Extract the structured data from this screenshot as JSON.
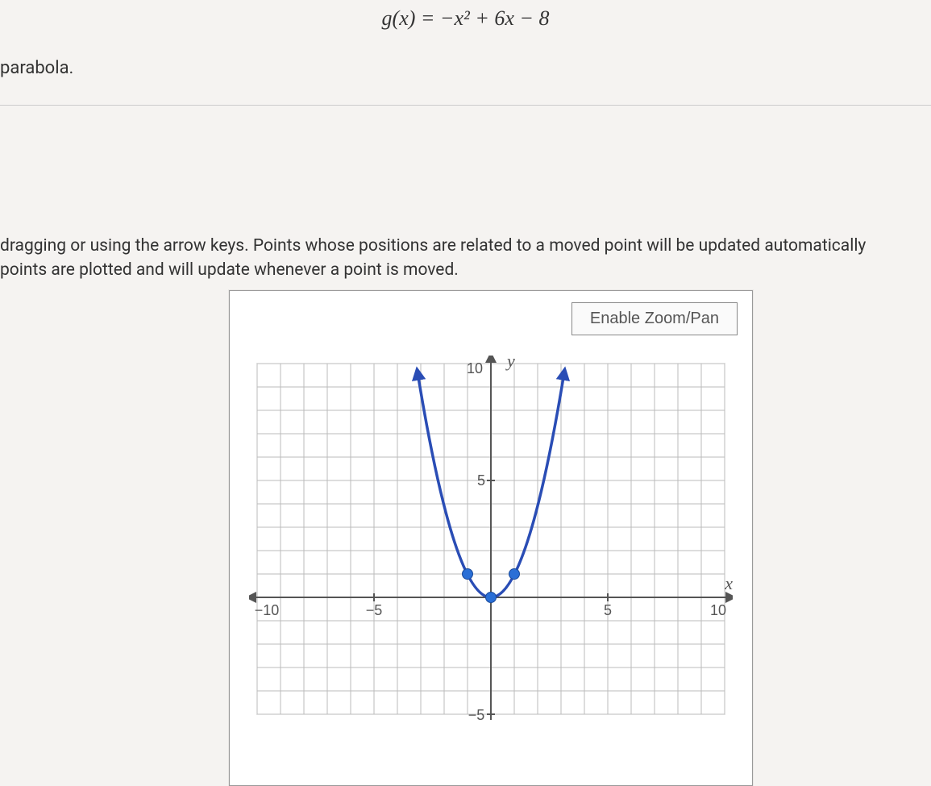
{
  "equation": "g(x) = −x² + 6x − 8",
  "parabola_label": "parabola.",
  "description_line1": "dragging or using the arrow keys. Points whose positions are related to a moved point will be updated automatically",
  "description_line2": "points are plotted and will update whenever a point is moved.",
  "zoom_button": "Enable Zoom/Pan",
  "chart_data": {
    "type": "line",
    "title": "",
    "xlabel": "x",
    "ylabel": "y",
    "xlim": [
      -10,
      10
    ],
    "ylim": [
      -5,
      10
    ],
    "x_ticks": [
      -10,
      -5,
      5,
      10
    ],
    "y_ticks": [
      -5,
      5,
      10
    ],
    "series": [
      {
        "name": "parabola",
        "x": [
          -3,
          -2.5,
          -2,
          -1.5,
          -1,
          -0.5,
          0,
          0.5,
          1,
          1.5,
          2,
          2.5,
          3
        ],
        "y": [
          9,
          6.25,
          4,
          2.25,
          1,
          0.25,
          0,
          0.25,
          1,
          2.25,
          4,
          6.25,
          9
        ]
      }
    ],
    "points": [
      {
        "x": -1,
        "y": 1
      },
      {
        "x": 0,
        "y": 0
      },
      {
        "x": 1,
        "y": 1
      }
    ]
  }
}
